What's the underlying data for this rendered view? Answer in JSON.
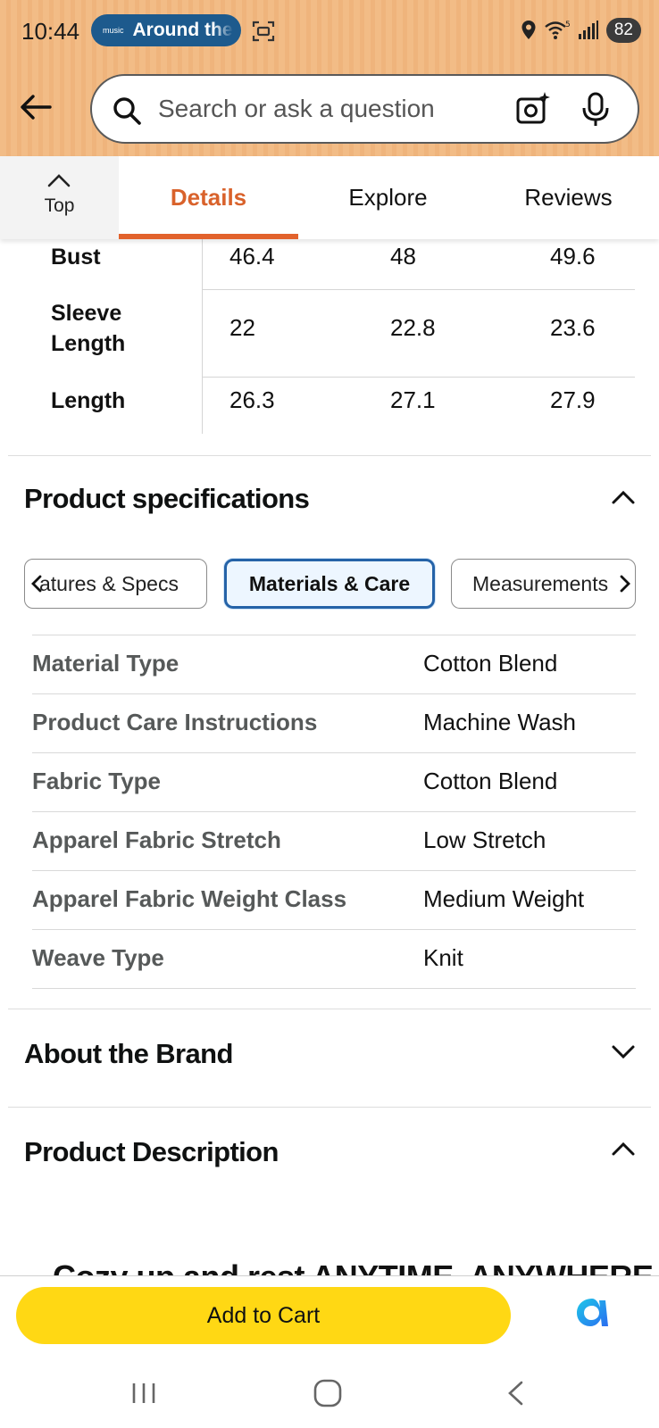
{
  "status_bar": {
    "time": "10:44",
    "music_logo": "music",
    "music_text": "Around the",
    "battery": "82",
    "icons": [
      "screenshot-icon",
      "location-icon",
      "wifi-icon",
      "signal-icon"
    ]
  },
  "search": {
    "placeholder": "Search or ask a question",
    "icons": [
      "back-arrow-icon",
      "search-icon",
      "camera-icon",
      "mic-icon"
    ]
  },
  "tabs": {
    "top_label": "Top",
    "items": [
      {
        "label": "Details",
        "active": true
      },
      {
        "label": "Explore",
        "active": false
      },
      {
        "label": "Reviews",
        "active": false
      }
    ]
  },
  "size_chart": {
    "rows": [
      {
        "label": "Bust",
        "values": [
          "46.4",
          "48",
          "49.6"
        ]
      },
      {
        "label": "Sleeve Length",
        "values": [
          "22",
          "22.8",
          "23.6"
        ]
      },
      {
        "label": "Length",
        "values": [
          "26.3",
          "27.1",
          "27.9"
        ]
      }
    ]
  },
  "specs": {
    "title": "Product specifications",
    "pills": [
      "atures & Specs",
      "Materials & Care",
      "Measurements"
    ],
    "active_pill": "Materials & Care",
    "rows": [
      {
        "key": "Material Type",
        "value": "Cotton Blend"
      },
      {
        "key": "Product Care Instructions",
        "value": "Machine Wash"
      },
      {
        "key": "Fabric Type",
        "value": "Cotton Blend"
      },
      {
        "key": "Apparel Fabric Stretch",
        "value": "Low Stretch"
      },
      {
        "key": "Apparel Fabric Weight Class",
        "value": "Medium Weight"
      },
      {
        "key": "Weave Type",
        "value": "Knit"
      }
    ]
  },
  "brand": {
    "title": "About the Brand"
  },
  "description": {
    "title": "Product Description",
    "peek_text": "Cozy up and rest ANYTIME, ANYWHERE"
  },
  "bottom": {
    "cart_label": "Add to Cart",
    "icons": [
      "alexa-icon",
      "recent-apps-icon",
      "home-icon",
      "back-icon"
    ]
  },
  "colors": {
    "header_bg": "#f2bc86",
    "tab_accent": "#e2622c",
    "pill_active_border": "#2563a8",
    "cart_button": "#ffd814",
    "music_pill": "#1d5a8d"
  }
}
